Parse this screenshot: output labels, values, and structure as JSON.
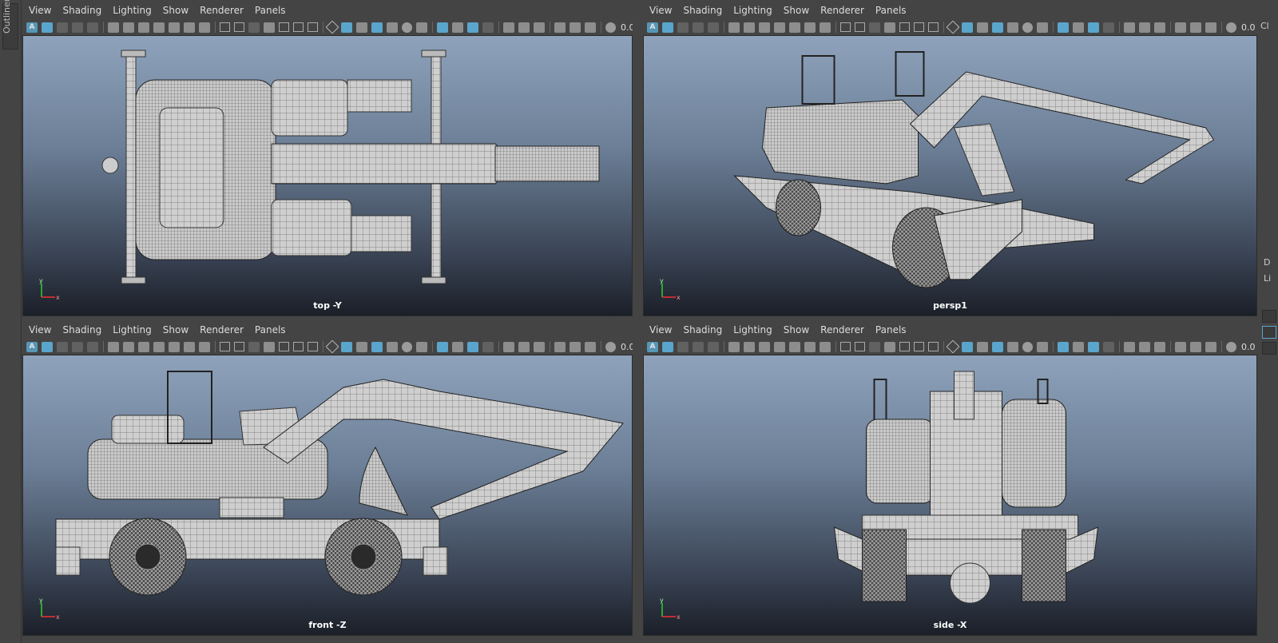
{
  "sidebar": {
    "outliner_label": "Outliner"
  },
  "right_strip": {
    "top_text": "Cl",
    "mid_text_1": "D",
    "mid_text_2": "Li"
  },
  "menus": [
    "View",
    "Shading",
    "Lighting",
    "Show",
    "Renderer",
    "Panels"
  ],
  "toolbar_value": "0.0",
  "panels": [
    {
      "id": "top",
      "label": "top -Y",
      "axes": [
        "y",
        "x"
      ]
    },
    {
      "id": "persp",
      "label": "persp1",
      "axes": [
        "y",
        "x"
      ]
    },
    {
      "id": "front",
      "label": "front -Z",
      "axes": [
        "y",
        "x"
      ]
    },
    {
      "id": "side",
      "label": "side -X",
      "axes": [
        "y",
        "x"
      ]
    }
  ],
  "icons": [
    "select-camera-icon",
    "camera-icon",
    "wireframe-icon",
    "grid-icon",
    "film-gate-icon",
    "resolution-gate-icon",
    "shaded-icon",
    "textured-icon",
    "lights-icon",
    "shadows-icon",
    "xray-icon",
    "isolate-icon",
    "frame-all-icon",
    "exposure-icon"
  ],
  "colors": {
    "accent": "#5aa5cc",
    "panel_bg": "#444444",
    "viewport_top": "#8ea2bb",
    "viewport_bottom": "#1b1f28"
  }
}
